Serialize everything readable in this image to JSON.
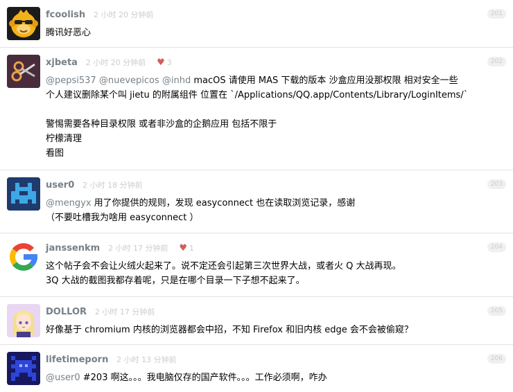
{
  "replies": [
    {
      "username": "fcoolish",
      "time": "2 小时 20 分钟前",
      "floor": "201",
      "likes": null,
      "avatar_icon": "sunglasses-monkey-avatar",
      "lines": [
        "腾讯好恶心"
      ]
    },
    {
      "username": "xjbeta",
      "time": "2 小时 20 分钟前",
      "floor": "202",
      "likes": "3",
      "avatar_icon": "scissors-avatar",
      "mentions": [
        "@pepsi537",
        "@nuevepicos",
        "@inhd"
      ],
      "line1_rest": " macOS 请使用 MAS 下载的版本 沙盒应用没那权限 相对安全一些",
      "lines": [
        "个人建议删除某个叫 jietu 的附属组件 位置在 `/Applications/QQ.app/Contents/Library/LoginItems/`",
        "",
        "警惕需要各种目录权限 或者非沙盒的企鹅应用 包括不限于",
        "柠檬清理",
        "看图"
      ]
    },
    {
      "username": "user0",
      "time": "2 小时 18 分钟前",
      "floor": "203",
      "likes": null,
      "avatar_icon": "space-invader-avatar",
      "mention": "@mengyx",
      "line1_rest": " 用了你提供的规则，发现 easyconnect 也在读取浏览记录，感谢",
      "lines": [
        "（不要吐槽我为啥用 easyconnect ）"
      ]
    },
    {
      "username": "janssenkm",
      "time": "2 小时 17 分钟前",
      "floor": "204",
      "likes": "1",
      "avatar_icon": "google-g-avatar",
      "lines": [
        "这个帖子会不会让火绒火起来了。说不定还会引起第三次世界大战，或者火 Q 大战再现。",
        "3Q 大战的截图我都存着呢，只是在哪个目录一下子想不起来了。"
      ]
    },
    {
      "username": "DOLLOR",
      "time": "2 小时 17 分钟前",
      "floor": "205",
      "likes": null,
      "avatar_icon": "anime-girl-avatar",
      "lines": [
        "好像基于 chromium 内核的浏览器都会中招，不知 Firefox 和旧内核 edge 会不会被偷窥？"
      ]
    },
    {
      "username": "lifetimeporn",
      "time": "2 小时 13 分钟前",
      "floor": "206",
      "likes": null,
      "avatar_icon": "pixel-robot-avatar",
      "mention": "@user0",
      "line1_rest": " #203 啊这。。。我电脑仅存的国产软件。。。工作必须啊，咋办",
      "lines": []
    }
  ],
  "colors": {
    "username": "#778087",
    "meta": "#cccccc",
    "heart": "#d35d5d",
    "divider": "#e2e2e2"
  }
}
